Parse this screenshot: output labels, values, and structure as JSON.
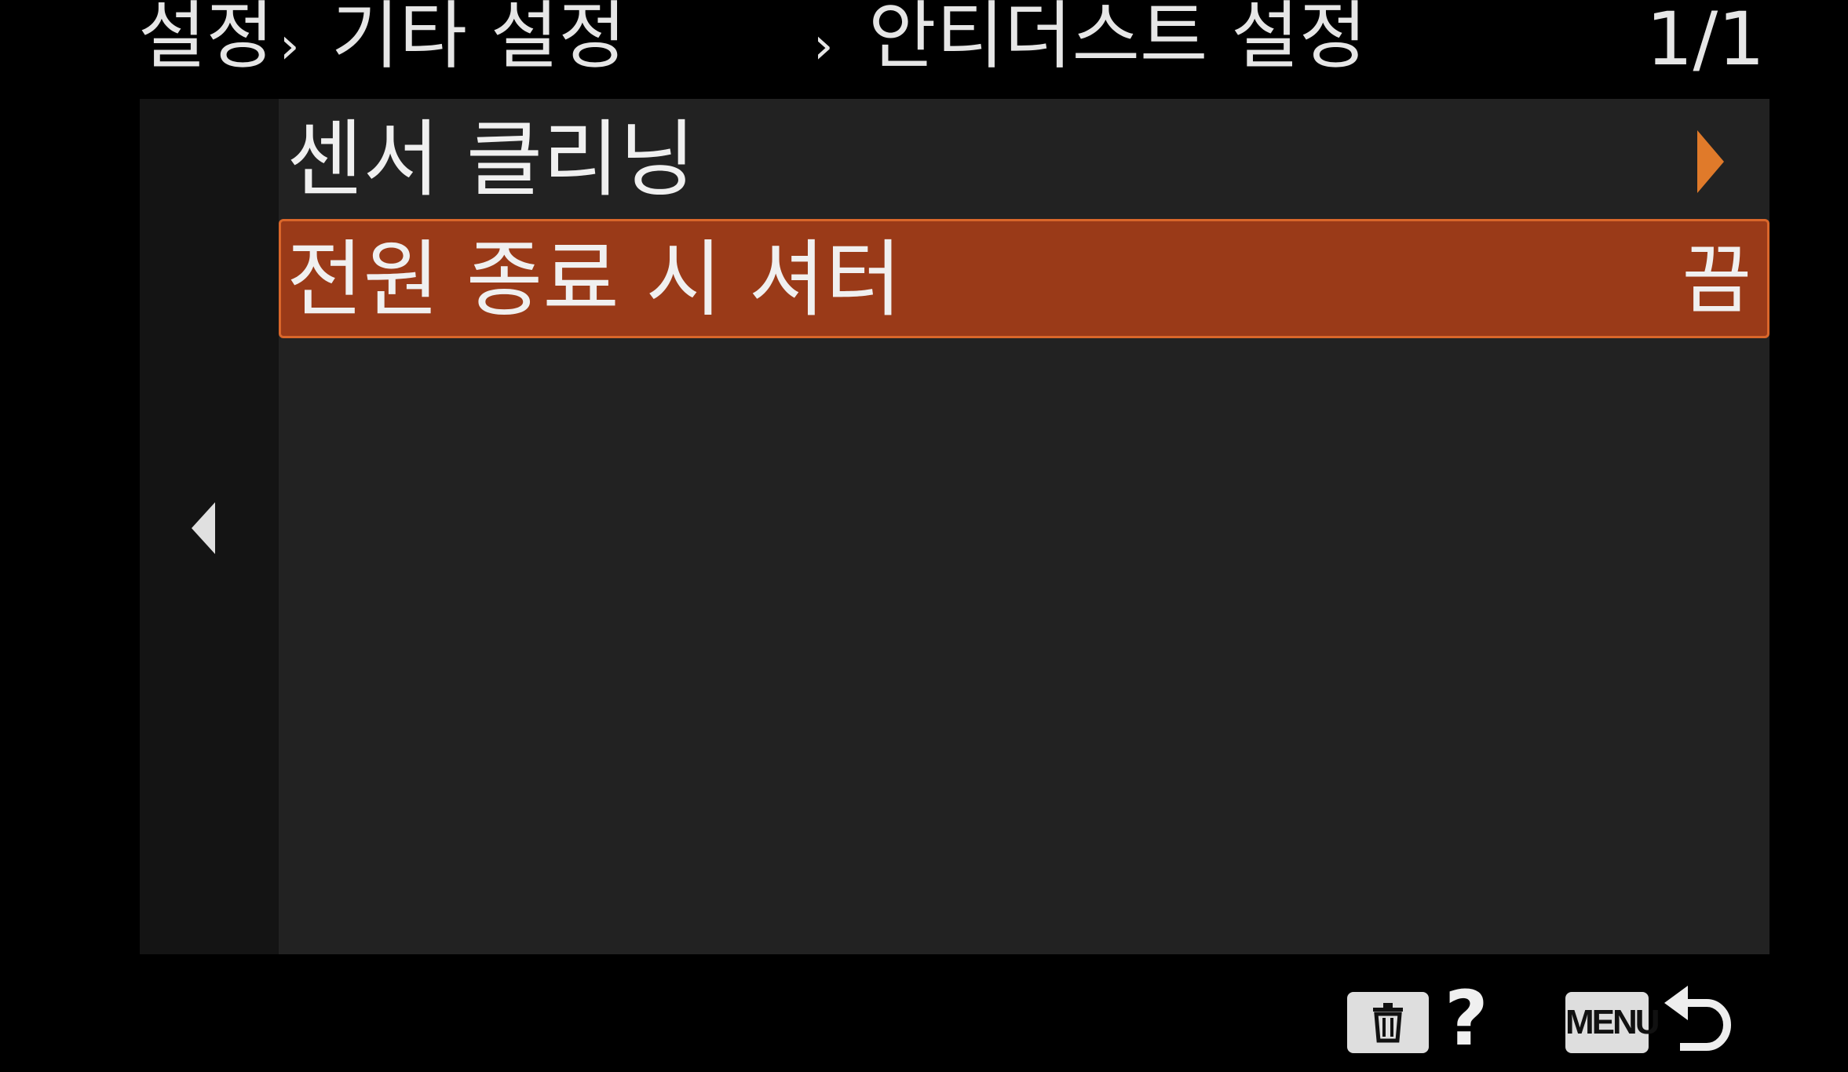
{
  "header": {
    "breadcrumb": [
      "설정",
      "기타 설정",
      "안티더스트 설정"
    ],
    "separator": "›",
    "page_indicator": "1/1"
  },
  "side_nav": {
    "back_icon": "chevron-left-icon"
  },
  "menu": {
    "items": [
      {
        "label": "센서 클리닝",
        "value": "",
        "icon": "chevron-right-icon",
        "selected": false
      },
      {
        "label": "전원 종료 시 셔터",
        "value": "끔",
        "selected": true
      }
    ]
  },
  "footer": {
    "delete_icon": "trash-icon",
    "help_label": "?",
    "menu_label": "MENU",
    "return_icon": "return-arrow-icon"
  },
  "colors": {
    "background": "#000000",
    "panel": "#222222",
    "side_nav": "#141414",
    "selected_fill": "#9a3a18",
    "selected_border": "#d9662a",
    "accent_arrow": "#e07a2a",
    "text": "#f0f0f0"
  }
}
